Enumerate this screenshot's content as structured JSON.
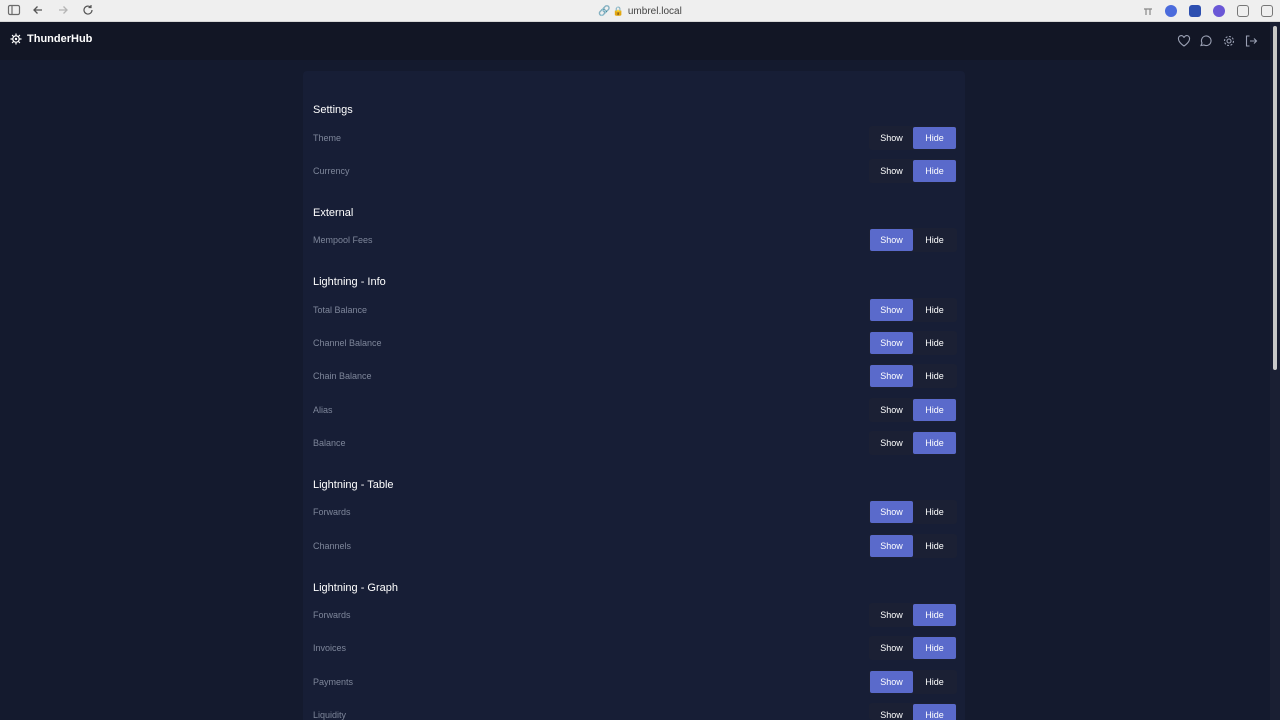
{
  "browser": {
    "url": "umbrel.local",
    "icons": [
      "sidebar-icon",
      "back-icon",
      "forward-icon",
      "reload-icon",
      "link-icon",
      "lock-icon"
    ]
  },
  "app": {
    "title": "ThunderHub",
    "header_icons": [
      "heart-icon",
      "chat-icon",
      "gear-icon",
      "logout-icon"
    ]
  },
  "options": {
    "show": "Show",
    "hide": "Hide"
  },
  "accent_color": "#5a6acb",
  "sections": [
    {
      "title": "Settings",
      "rows": [
        {
          "label": "Theme",
          "value": "Hide"
        },
        {
          "label": "Currency",
          "value": "Hide"
        }
      ]
    },
    {
      "title": "External",
      "rows": [
        {
          "label": "Mempool Fees",
          "value": "Show"
        }
      ]
    },
    {
      "title": "Lightning - Info",
      "rows": [
        {
          "label": "Total Balance",
          "value": "Show"
        },
        {
          "label": "Channel Balance",
          "value": "Show"
        },
        {
          "label": "Chain Balance",
          "value": "Show"
        },
        {
          "label": "Alias",
          "value": "Hide"
        },
        {
          "label": "Balance",
          "value": "Hide"
        }
      ]
    },
    {
      "title": "Lightning - Table",
      "rows": [
        {
          "label": "Forwards",
          "value": "Show"
        },
        {
          "label": "Channels",
          "value": "Show"
        }
      ]
    },
    {
      "title": "Lightning - Graph",
      "rows": [
        {
          "label": "Forwards",
          "value": "Hide"
        },
        {
          "label": "Invoices",
          "value": "Hide"
        },
        {
          "label": "Payments",
          "value": "Show"
        },
        {
          "label": "Liquidity",
          "value": "Hide"
        }
      ]
    }
  ]
}
